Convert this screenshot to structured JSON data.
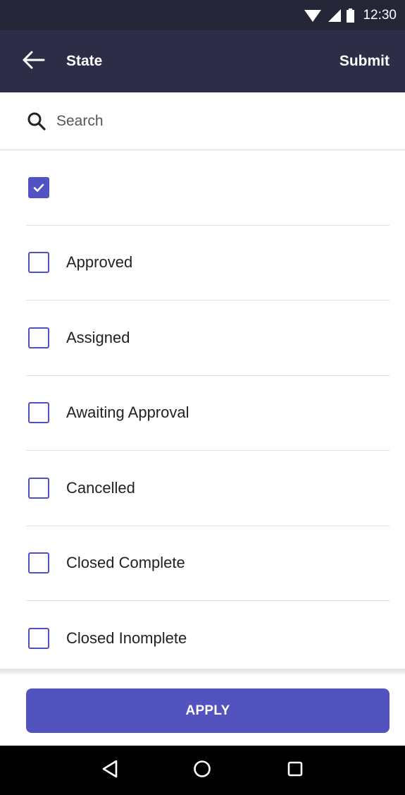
{
  "status_bar": {
    "time": "12:30",
    "icons": [
      "wifi-icon",
      "signal-icon",
      "battery-icon"
    ]
  },
  "app_bar": {
    "back_icon": "arrow-left-icon",
    "title": "State",
    "submit_label": "Submit"
  },
  "search": {
    "icon": "search-icon",
    "placeholder": "Search",
    "value": ""
  },
  "list": {
    "items": [
      {
        "label": "",
        "checked": true
      },
      {
        "label": "Approved",
        "checked": false
      },
      {
        "label": "Assigned",
        "checked": false
      },
      {
        "label": "Awaiting Approval",
        "checked": false
      },
      {
        "label": "Cancelled",
        "checked": false
      },
      {
        "label": "Closed Complete",
        "checked": false
      },
      {
        "label": "Closed Inomplete",
        "checked": false
      }
    ]
  },
  "footer": {
    "apply_label": "APPLY"
  },
  "nav_bar": {
    "icons": [
      "back-triangle-icon",
      "home-circle-icon",
      "recents-square-icon"
    ]
  },
  "colors": {
    "status_bar_bg": "#252538",
    "app_bar_bg": "#2e2d48",
    "accent": "#5353c0",
    "nav_bar_bg": "#000000"
  }
}
